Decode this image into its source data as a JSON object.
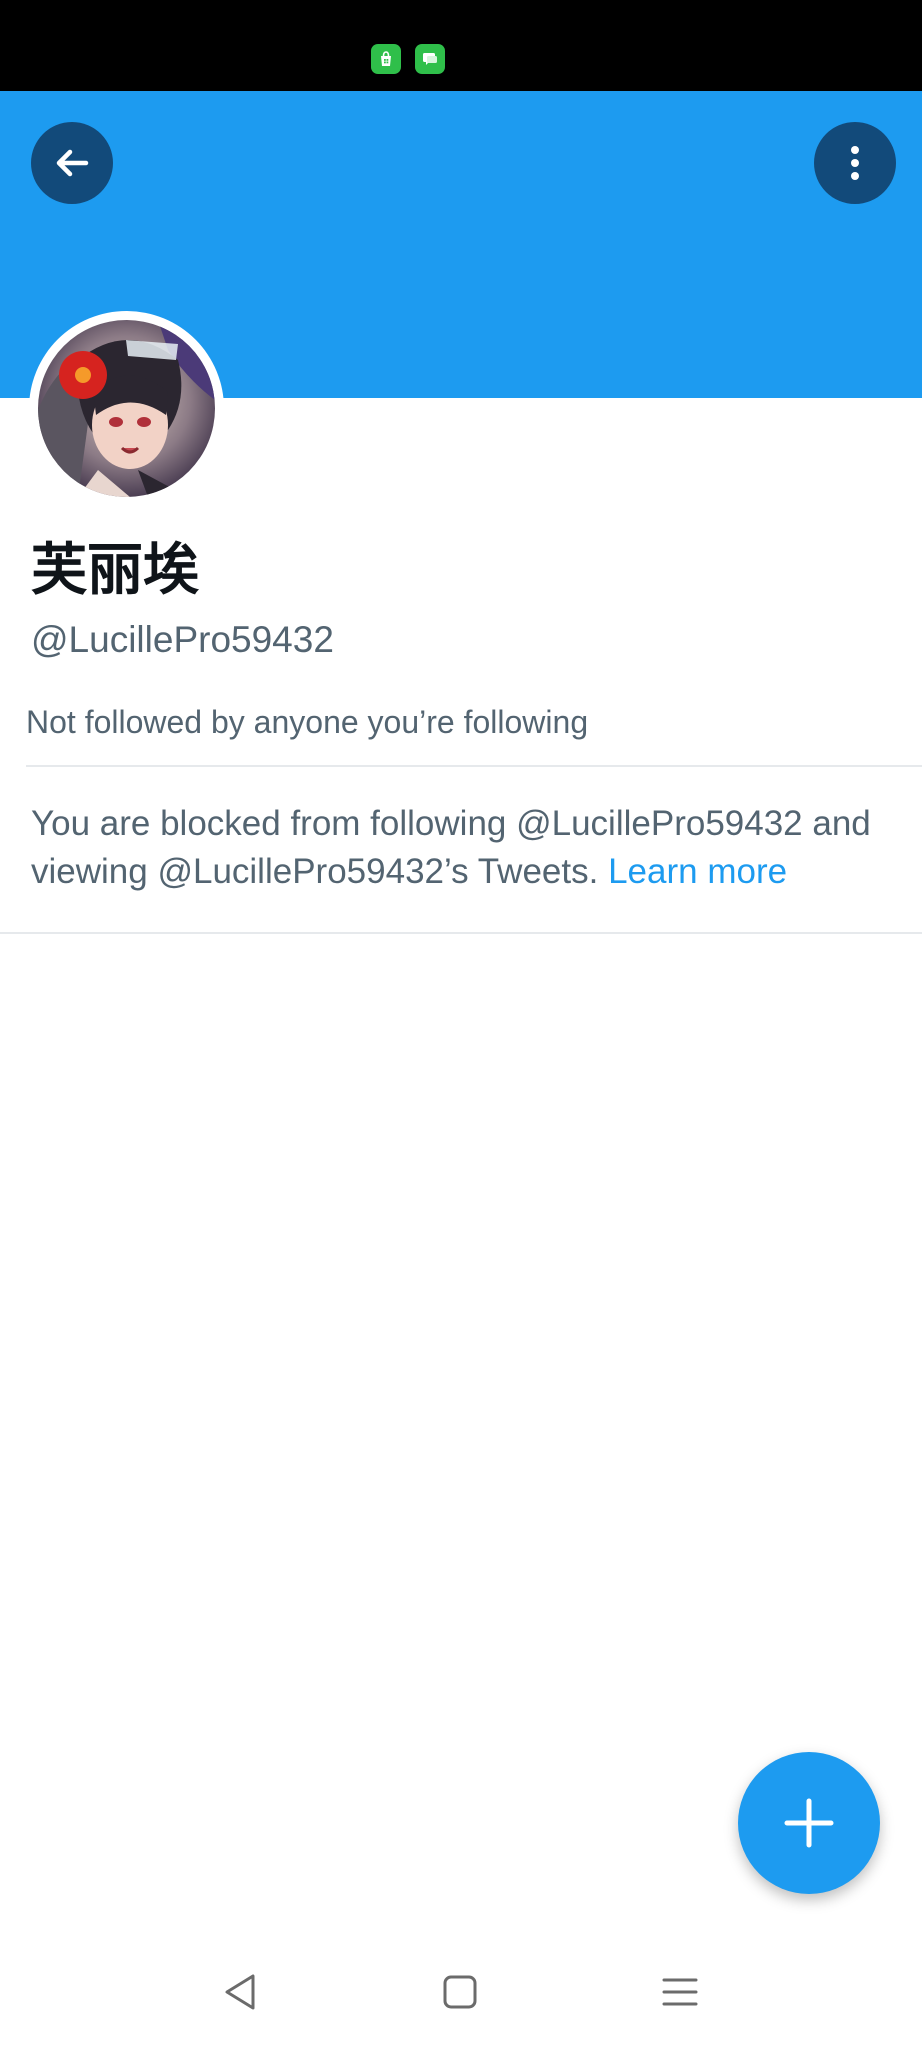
{
  "status_bar": {
    "apps": [
      "shopping-bag-app-icon",
      "chat-app-icon"
    ]
  },
  "header": {
    "back_icon": "arrow-left-icon",
    "more_icon": "vertical-dots-icon",
    "banner_color": "#1d9bf0"
  },
  "profile": {
    "display_name": "芙丽埃",
    "handle": "@LucillePro59432",
    "followers_note": "Not followed by anyone you’re following"
  },
  "blocked": {
    "message": "You are blocked from following @LucillePro59432 and viewing @LucillePro59432’s Tweets.",
    "link_label": "Learn more"
  },
  "fab": {
    "icon": "plus-icon"
  },
  "nav_bar": {
    "icons": [
      "back-triangle-icon",
      "home-square-icon",
      "recents-menu-icon"
    ]
  },
  "colors": {
    "accent": "#1d9bf0",
    "header_button": "#124a7a",
    "secondary_text": "#536471"
  }
}
